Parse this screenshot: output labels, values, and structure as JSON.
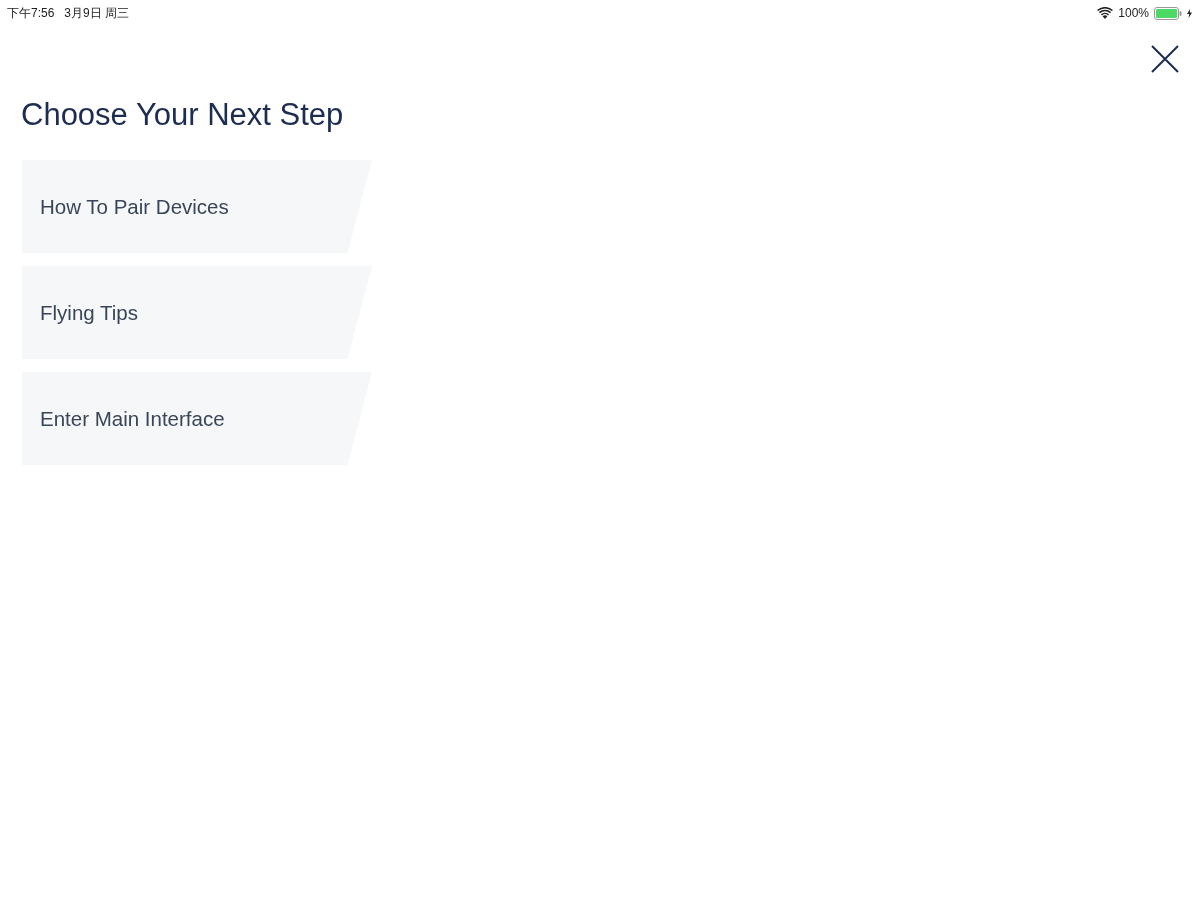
{
  "status_bar": {
    "time": "下午7:56",
    "date": "3月9日 周三",
    "battery_percent": "100%"
  },
  "title": "Choose Your Next Step",
  "options": [
    {
      "label": "How To Pair Devices"
    },
    {
      "label": "Flying Tips"
    },
    {
      "label": "Enter Main Interface"
    }
  ]
}
